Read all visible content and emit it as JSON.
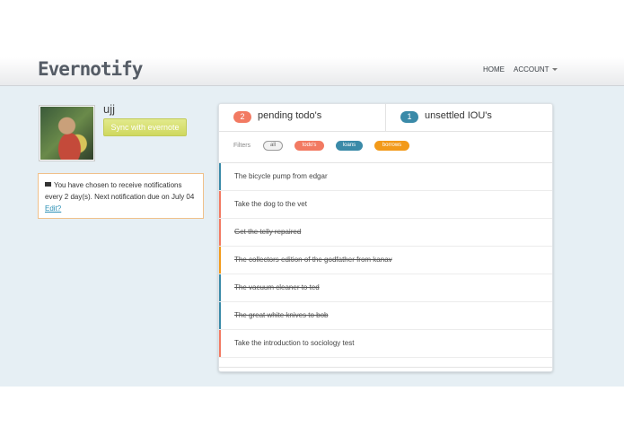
{
  "colors": {
    "todo": "#f27a62",
    "loan": "#3a8aa8",
    "borrow": "#f29a1a",
    "sync": "#d6de6a",
    "link": "#2a8fb5"
  },
  "navbar": {
    "brand": "Evernotify",
    "home": "HOME",
    "account": "ACCOUNT"
  },
  "profile": {
    "username": "ujj",
    "sync_label": "Sync with evernote"
  },
  "notice": {
    "text": "You have chosen to receive notifications every 2 day(s). Next notification due on July 04",
    "edit": "Edit?"
  },
  "tabs": {
    "todo": {
      "count": "2",
      "label": "pending todo's"
    },
    "iou": {
      "count": "1",
      "label": "unsettled IOU's"
    }
  },
  "filters": {
    "label": "Filters",
    "options": [
      "all",
      "todo's",
      "loans",
      "borrows"
    ]
  },
  "items": [
    {
      "text": "The bicycle pump from edgar",
      "kind": "loan",
      "done": false
    },
    {
      "text": "Take the dog to the vet",
      "kind": "todo",
      "done": false
    },
    {
      "text": "Get the telly repaired",
      "kind": "todo",
      "done": true
    },
    {
      "text": "The collectors edition of the godfather from kanav",
      "kind": "borrow",
      "done": true
    },
    {
      "text": "The vacuum cleaner to ted",
      "kind": "loan",
      "done": true
    },
    {
      "text": "The great white knives to bob",
      "kind": "loan",
      "done": true
    },
    {
      "text": "Take the introduction to sociology test",
      "kind": "todo",
      "done": false
    }
  ]
}
